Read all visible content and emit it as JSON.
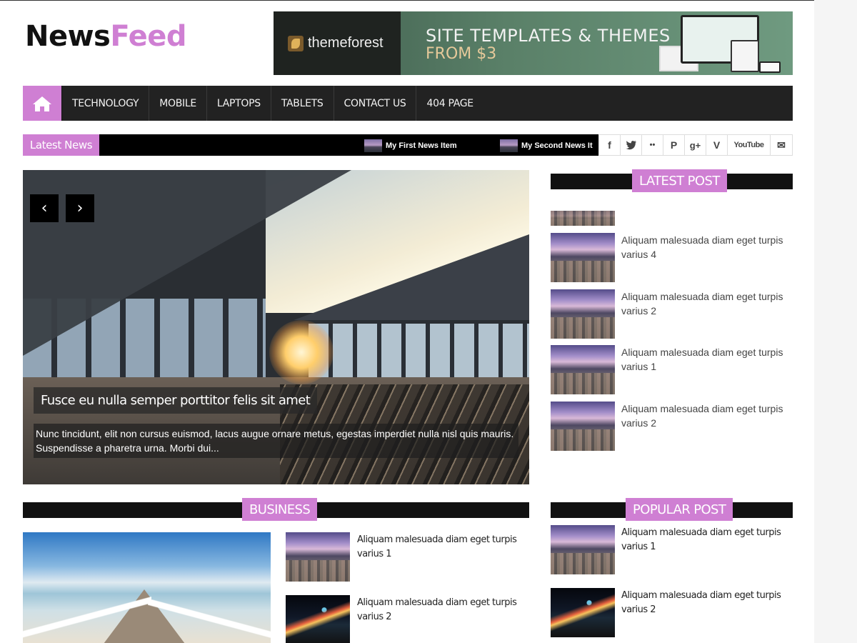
{
  "header": {
    "logo_part1": "News",
    "logo_part2": "Feed",
    "banner": {
      "brand": "themeforest",
      "line1": "SITE TEMPLATES & THEMES",
      "line2": "FROM $3"
    }
  },
  "nav": {
    "home_icon": "home-icon",
    "items": [
      "TECHNOLOGY",
      "MOBILE",
      "LAPTOPS",
      "TABLETS",
      "CONTACT US",
      "404 PAGE"
    ]
  },
  "ticker": {
    "label": "Latest News",
    "items": [
      "My First News Item",
      "My Second News It"
    ]
  },
  "social": [
    "facebook-icon",
    "twitter-icon",
    "flickr-icon",
    "pinterest-icon",
    "google-plus-icon",
    "vimeo-icon",
    "youtube-icon",
    "mail-icon"
  ],
  "social_glyphs": {
    "facebook": "f",
    "twitter": "t",
    "flickr": "••",
    "pinterest": "P",
    "google_plus": "g+",
    "vimeo": "V",
    "youtube": "YouTube",
    "mail": "✉"
  },
  "slider": {
    "prev": "‹",
    "next": "›",
    "title": "Fusce eu nulla semper porttitor felis sit amet",
    "description": "Nunc tincidunt, elit non cursus euismod, lacus augue ornare metus, egestas imperdiet nulla nisl quis mauris. Suspendisse a pharetra urna. Morbi dui..."
  },
  "latest_post": {
    "heading": "LATEST POST",
    "items": [
      "Aliquam malesuada diam eget turpis varius 4",
      "Aliquam malesuada diam eget turpis varius 2",
      "Aliquam malesuada diam eget turpis varius 1",
      "Aliquam malesuada diam eget turpis varius 2"
    ]
  },
  "business": {
    "heading": "BUSINESS",
    "items": [
      "Aliquam malesuada diam eget turpis varius 1",
      "Aliquam malesuada diam eget turpis varius 2"
    ]
  },
  "popular_post": {
    "heading": "POPULAR POST",
    "items": [
      "Aliquam malesuada diam eget turpis varius 1",
      "Aliquam malesuada diam eget turpis varius 2"
    ]
  },
  "colors": {
    "accent": "#cf7fd3",
    "dark_bar": "#222222",
    "ticker_bg": "#000000"
  }
}
